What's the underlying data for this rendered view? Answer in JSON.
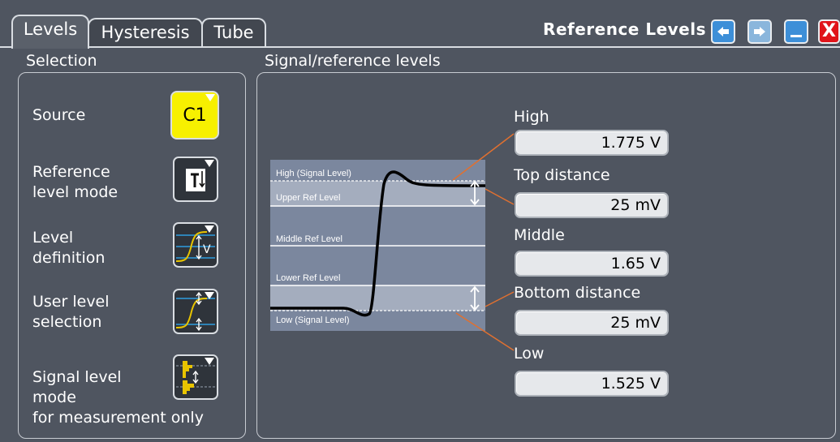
{
  "tabs": [
    {
      "label": "Levels",
      "active": true
    },
    {
      "label": "Hysteresis",
      "active": false
    },
    {
      "label": "Tube",
      "active": false
    }
  ],
  "dialog": {
    "title": "Reference Levels",
    "buttons": [
      "undo-icon",
      "redo-icon",
      "minimize-icon",
      "close-icon"
    ],
    "close_glyph": "X"
  },
  "selection": {
    "heading": "Selection",
    "source": {
      "label": "Source",
      "value": "C1",
      "color": "#f7f000"
    },
    "reference_level_mode": {
      "label": "Reference\nlevel mode",
      "icon": "reference-mode-icon"
    },
    "level_definition": {
      "label": "Level\ndefinition",
      "icon": "level-definition-icon"
    },
    "user_level_selection": {
      "label": "User level\nselection",
      "icon": "user-level-icon"
    },
    "signal_level_mode": {
      "label": "Signal level\nmode\nfor measurement only",
      "icon": "signal-histogram-icon"
    }
  },
  "levels": {
    "heading": "Signal/reference levels",
    "diagram_labels": {
      "high": "High (Signal Level)",
      "upper": "Upper Ref Level",
      "middle": "Middle Ref Level",
      "lower": "Lower Ref Level",
      "low": "Low (Signal Level)"
    },
    "fields": {
      "high": {
        "label": "High",
        "value": "1.775 V"
      },
      "top_distance": {
        "label": "Top distance",
        "value": "25 mV"
      },
      "middle": {
        "label": "Middle",
        "value": "1.65 V"
      },
      "bottom_distance": {
        "label": "Bottom distance",
        "value": "25 mV"
      },
      "low": {
        "label": "Low",
        "value": "1.525 V"
      }
    }
  },
  "colors": {
    "background": "#4f5560",
    "accent": "#3d8fd8",
    "close": "#e0141a",
    "leader_line": "#e07030",
    "diagram_bg": "#7b879e"
  }
}
